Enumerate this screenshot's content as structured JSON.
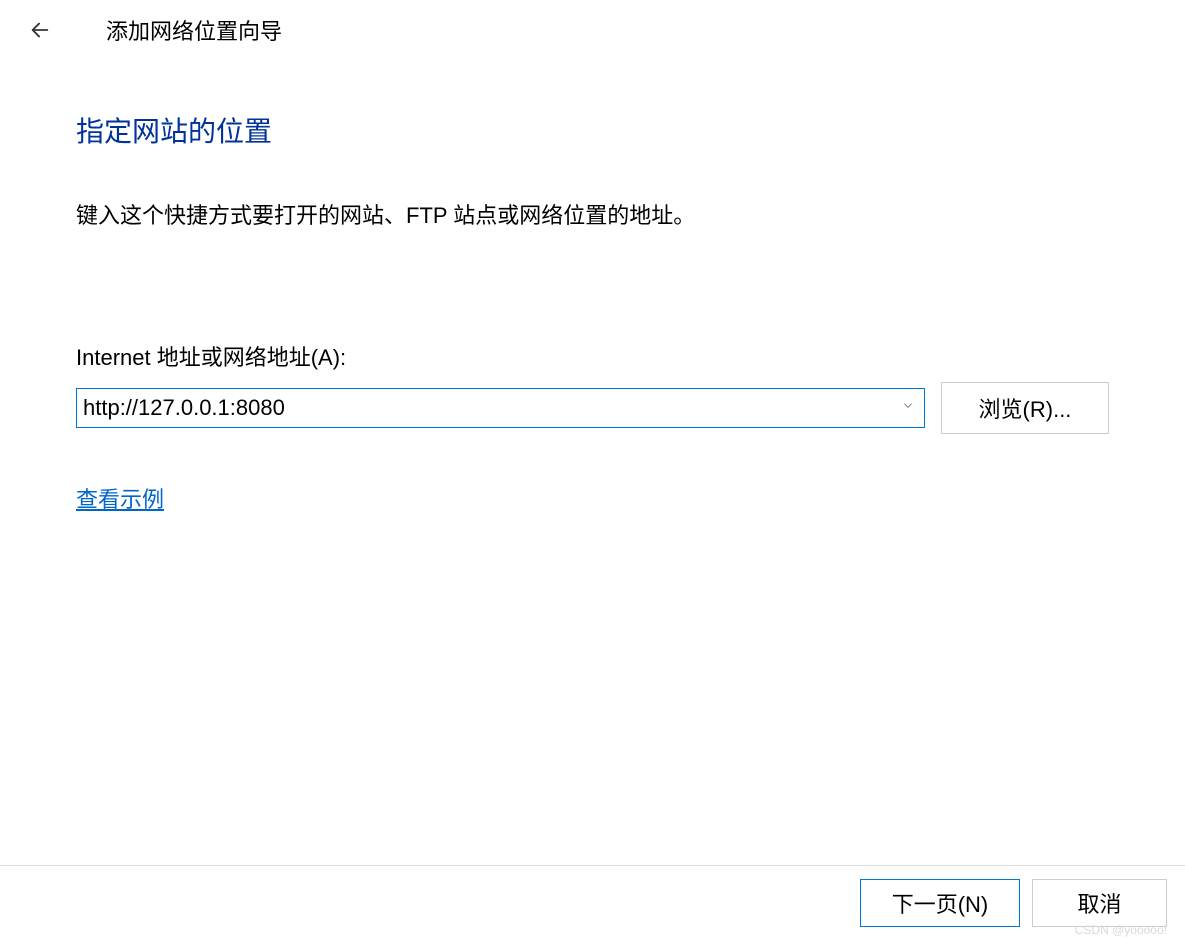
{
  "header": {
    "wizard_title": "添加网络位置向导"
  },
  "main": {
    "heading": "指定网站的位置",
    "instruction": "键入这个快捷方式要打开的网站、FTP 站点或网络位置的地址。",
    "field_label": "Internet 地址或网络地址(A):",
    "address_value": "http://127.0.0.1:8080",
    "browse_label": "浏览(R)...",
    "example_link": "查看示例"
  },
  "footer": {
    "next_label": "下一页(N)",
    "cancel_label": "取消"
  },
  "watermark": "CSDN @yooooo!"
}
